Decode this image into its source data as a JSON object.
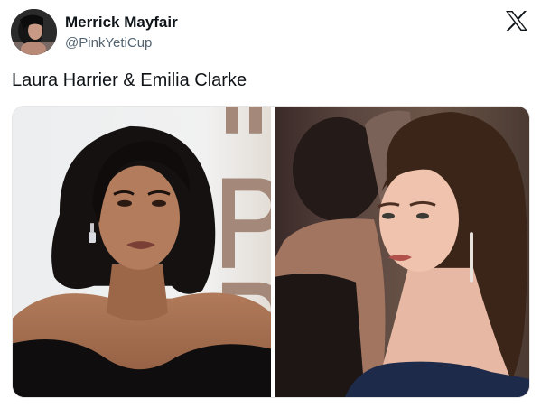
{
  "post": {
    "author": {
      "name": "Merrick Mayfair",
      "handle": "@PinkYetiCup"
    },
    "text": "Laura Harrier & Emilia Clarke",
    "platform_icon": "x-logo-icon"
  },
  "media": [
    {
      "icon": "photo-laura-harrier"
    },
    {
      "icon": "photo-emilia-clarke"
    }
  ]
}
